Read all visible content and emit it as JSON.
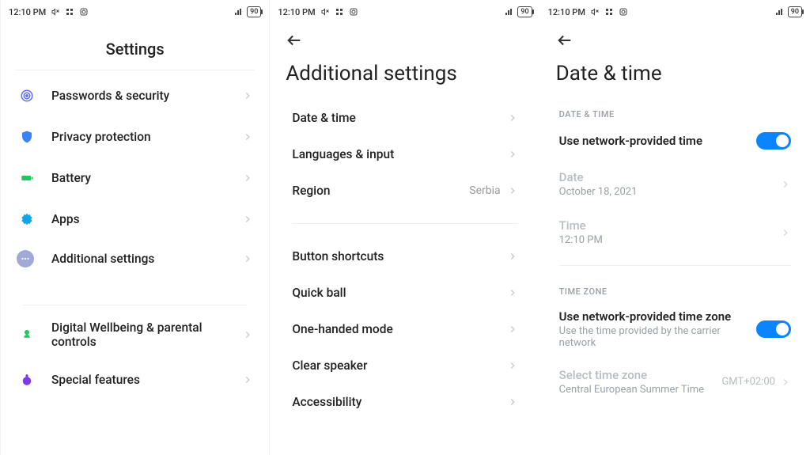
{
  "status": {
    "time": "12:10 PM",
    "battery": "90"
  },
  "screen1": {
    "title": "Settings",
    "items": [
      {
        "label": "Passwords & security",
        "icon": "fingerprint",
        "color": "#5b6ef5"
      },
      {
        "label": "Privacy protection",
        "icon": "shield",
        "color": "#3b82f6"
      },
      {
        "label": "Battery",
        "icon": "battery",
        "color": "#22c55e"
      },
      {
        "label": "Apps",
        "icon": "gear",
        "color": "#0ea5e9"
      },
      {
        "label": "Additional settings",
        "icon": "dots",
        "color": "#a1a9d6"
      }
    ],
    "items2": [
      {
        "label": "Digital Wellbeing & parental controls",
        "icon": "wellbeing",
        "color": "#22c55e"
      },
      {
        "label": "Special features",
        "icon": "special",
        "color": "#7c3aed"
      }
    ]
  },
  "screen2": {
    "title": "Additional settings",
    "group1": [
      {
        "label": "Date & time"
      },
      {
        "label": "Languages & input"
      },
      {
        "label": "Region",
        "value": "Serbia"
      }
    ],
    "group2": [
      {
        "label": "Button shortcuts"
      },
      {
        "label": "Quick ball"
      },
      {
        "label": "One-handed mode"
      },
      {
        "label": "Clear speaker"
      },
      {
        "label": "Accessibility"
      }
    ]
  },
  "screen3": {
    "title": "Date & time",
    "sec1": "DATE & TIME",
    "row_net_time": "Use network-provided time",
    "date_label": "Date",
    "date_value": "October 18, 2021",
    "time_label": "Time",
    "time_value": "12:10 PM",
    "sec2": "TIME ZONE",
    "row_net_tz": "Use network-provided time zone",
    "row_net_tz_sub": "Use the time provided by the carrier network",
    "tz_label": "Select time zone",
    "tz_sub": "Central European Summer Time",
    "tz_value": "GMT+02:00"
  }
}
